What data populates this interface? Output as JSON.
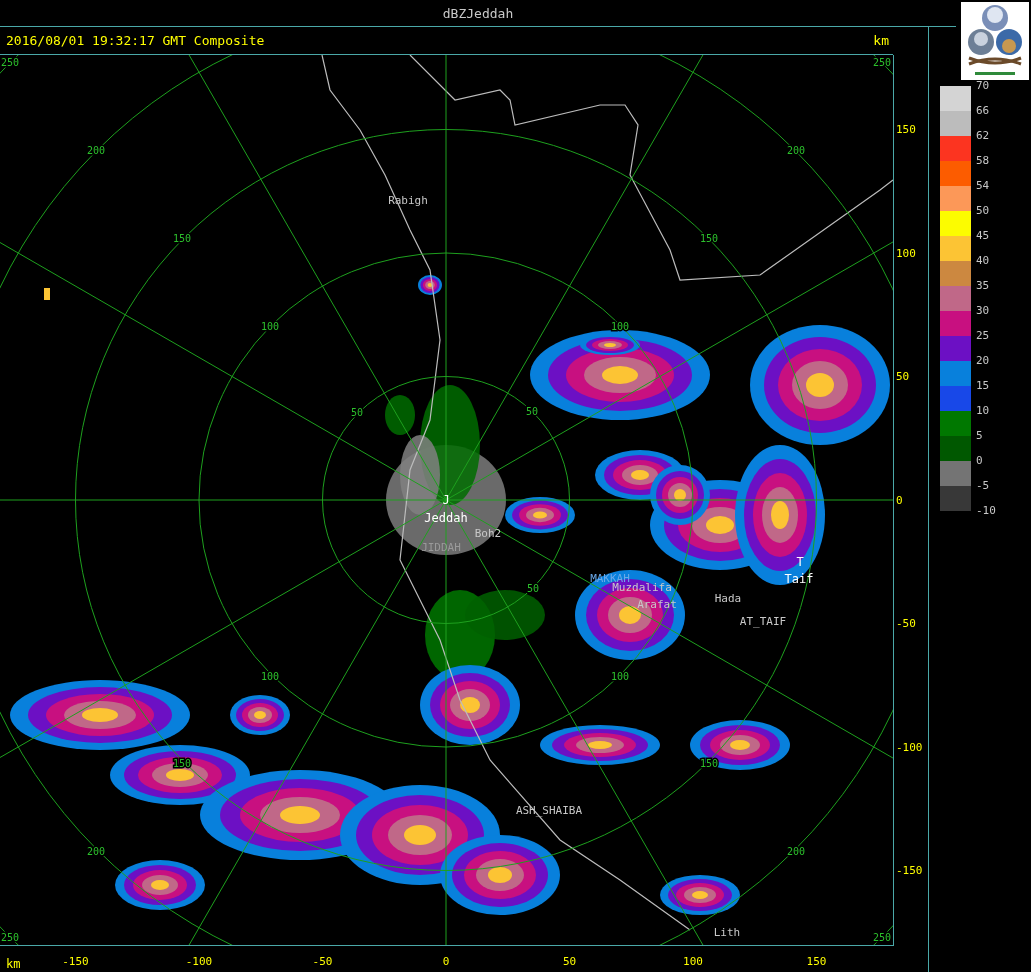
{
  "window": {
    "title": "dBZJeddah"
  },
  "header": {
    "caption": "2016/08/01 19:32:17 GMT Composite",
    "unit": "km"
  },
  "map": {
    "ring_labels": [
      "250",
      "250",
      "200",
      "200",
      "150",
      "150",
      "100",
      "100",
      "50",
      "50",
      "50",
      "100",
      "100",
      "150",
      "150",
      "200",
      "200",
      "250",
      "250"
    ],
    "places": [
      "Rabigh",
      "J",
      "Jeddah",
      "Boh2",
      "JIDDAH",
      "MAKKAH",
      "Muzdalifa",
      "Arafat",
      "Hada",
      "AT_TAIF",
      "T",
      "Taif",
      "ASH_SHAIBA",
      "Lith"
    ]
  },
  "y_axis": {
    "ticks": [
      "150",
      "100",
      "50",
      "0",
      "-50",
      "-100",
      "-150"
    ]
  },
  "x_axis": {
    "unit": "km",
    "ticks": [
      "-150",
      "-100",
      "-50",
      "0",
      "50",
      "100",
      "150"
    ]
  },
  "legend": {
    "labels": [
      "70",
      "66",
      "62",
      "58",
      "54",
      "50",
      "45",
      "40",
      "35",
      "30",
      "25",
      "20",
      "15",
      "10",
      "5",
      "0",
      "-5",
      "-10"
    ],
    "swatches": [
      {
        "color": "#d4d4d4"
      },
      {
        "color": "#bcbcbc"
      },
      {
        "color": "#fc3420"
      },
      {
        "color": "#fc5c00"
      },
      {
        "color": "#fc9858"
      },
      {
        "color": "#fcfc00"
      },
      {
        "color": "#fcc434"
      },
      {
        "color": "#cc8840"
      },
      {
        "color": "#c06888"
      },
      {
        "color": "#c81080"
      },
      {
        "color": "#6c10c4"
      },
      {
        "color": "#0880dc"
      },
      {
        "color": "#1848e8"
      },
      {
        "color": "#007800"
      },
      {
        "color": "#005800"
      },
      {
        "color": "#747474"
      },
      {
        "color": "#383838"
      }
    ]
  }
}
